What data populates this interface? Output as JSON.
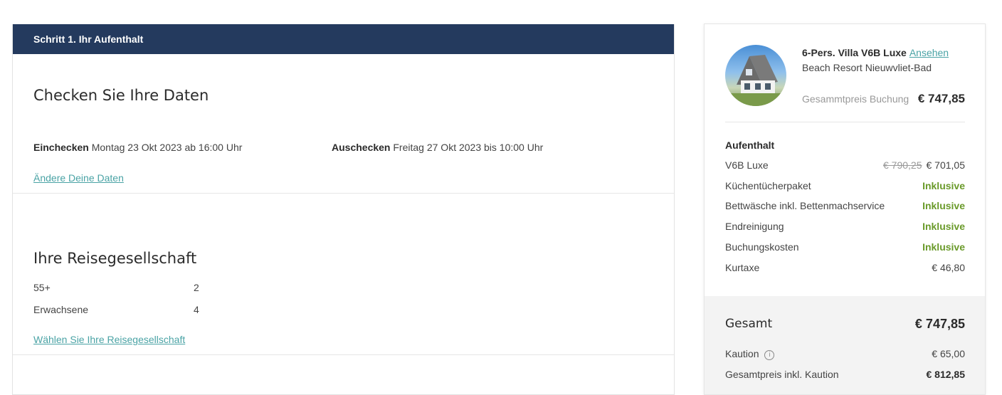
{
  "step": {
    "title": "Schritt 1. Ihr Aufenthalt"
  },
  "dates": {
    "heading": "Checken Sie Ihre Daten",
    "checkin_label": "Einchecken",
    "checkin_value": "Montag 23 Okt 2023 ab 16:00 Uhr",
    "checkout_label": "Auschecken",
    "checkout_value": "Freitag 27 Okt 2023 bis 10:00 Uhr",
    "change_link": "Ändere Deine Daten"
  },
  "party": {
    "heading": "Ihre Reisegesellschaft",
    "rows": [
      {
        "label": "55+",
        "count": "2"
      },
      {
        "label": "Erwachsene",
        "count": "4"
      }
    ],
    "change_link": "Wählen Sie Ihre Reisegesellschaft"
  },
  "summary": {
    "property_name": "6-Pers. Villa V6B Luxe",
    "view_link": "Ansehen",
    "resort": "Beach Resort Nieuwvliet-Bad",
    "total_label": "Gesammtpreis Buchung",
    "total_value": "€ 747,85",
    "stay_title": "Aufenthalt",
    "lines": [
      {
        "label": "V6B Luxe",
        "old": "€ 790,25",
        "value": "€ 701,05"
      },
      {
        "label": "Küchentücherpaket",
        "value": "Inklusive"
      },
      {
        "label": "Bettwäsche inkl. Bettenmachservice",
        "value": "Inklusive"
      },
      {
        "label": "Endreinigung",
        "value": "Inklusive"
      },
      {
        "label": "Buchungskosten",
        "value": "Inklusive"
      },
      {
        "label": "Kurtaxe",
        "value": "€ 46,80"
      }
    ],
    "grand_label": "Gesamt",
    "grand_value": "€ 747,85",
    "deposit_label": "Kaution",
    "deposit_value": "€ 65,00",
    "incl_deposit_label": "Gesamtpreis inkl. Kaution",
    "incl_deposit_value": "€ 812,85"
  },
  "colors": {
    "header_bg": "#243a5e",
    "link": "#4aa3a5",
    "included": "#6a9a2a"
  },
  "icons": {
    "deposit_info": "info-icon"
  }
}
